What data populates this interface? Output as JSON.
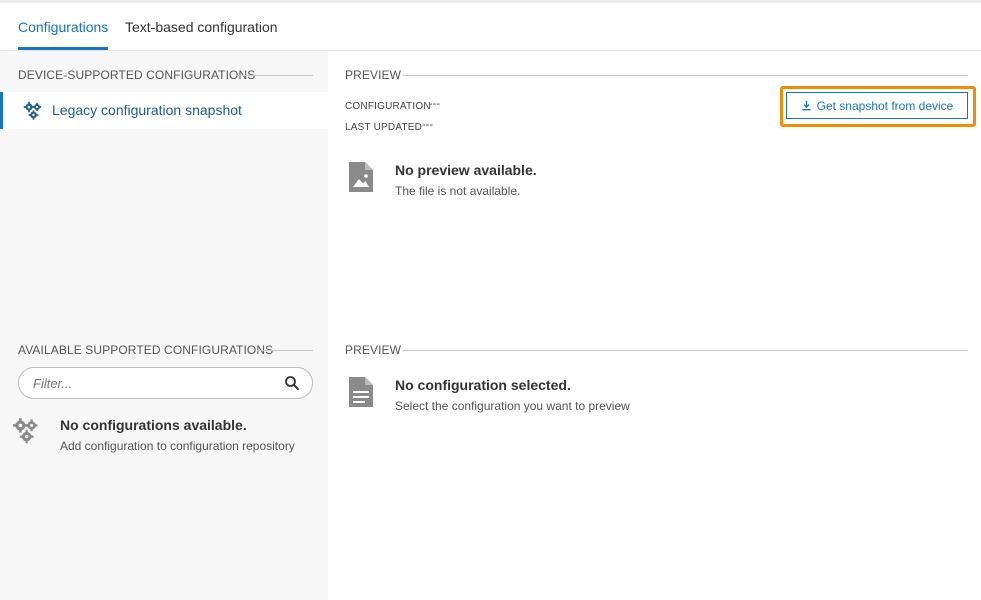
{
  "tabs": [
    {
      "label": "Configurations",
      "active": true
    },
    {
      "label": "Text-based configuration",
      "active": false
    }
  ],
  "left": {
    "device_supported": {
      "title": "DEVICE-SUPPORTED CONFIGURATIONS",
      "items": [
        {
          "label": "Legacy configuration snapshot",
          "icon": "gears-icon",
          "selected": true
        }
      ]
    },
    "available_supported": {
      "title": "AVAILABLE SUPPORTED CONFIGURATIONS",
      "filter_placeholder": "Filter...",
      "empty_title": "No configurations available.",
      "empty_subtitle": "Add configuration to configuration repository"
    }
  },
  "preview_top": {
    "title": "PREVIEW",
    "configuration_key": "CONFIGURATION",
    "configuration_value": "---",
    "last_updated_key": "LAST UPDATED",
    "last_updated_value": "---",
    "snapshot_button": "Get snapshot from device",
    "empty_title": "No preview available.",
    "empty_subtitle": "The file is not available."
  },
  "preview_bottom": {
    "title": "PREVIEW",
    "empty_title": "No configuration selected.",
    "empty_subtitle": "Select the configuration you want to preview"
  },
  "colors": {
    "accent": "#1776bf",
    "highlight": "#f28c00",
    "left_pane_bg": "#f7f7f7"
  }
}
